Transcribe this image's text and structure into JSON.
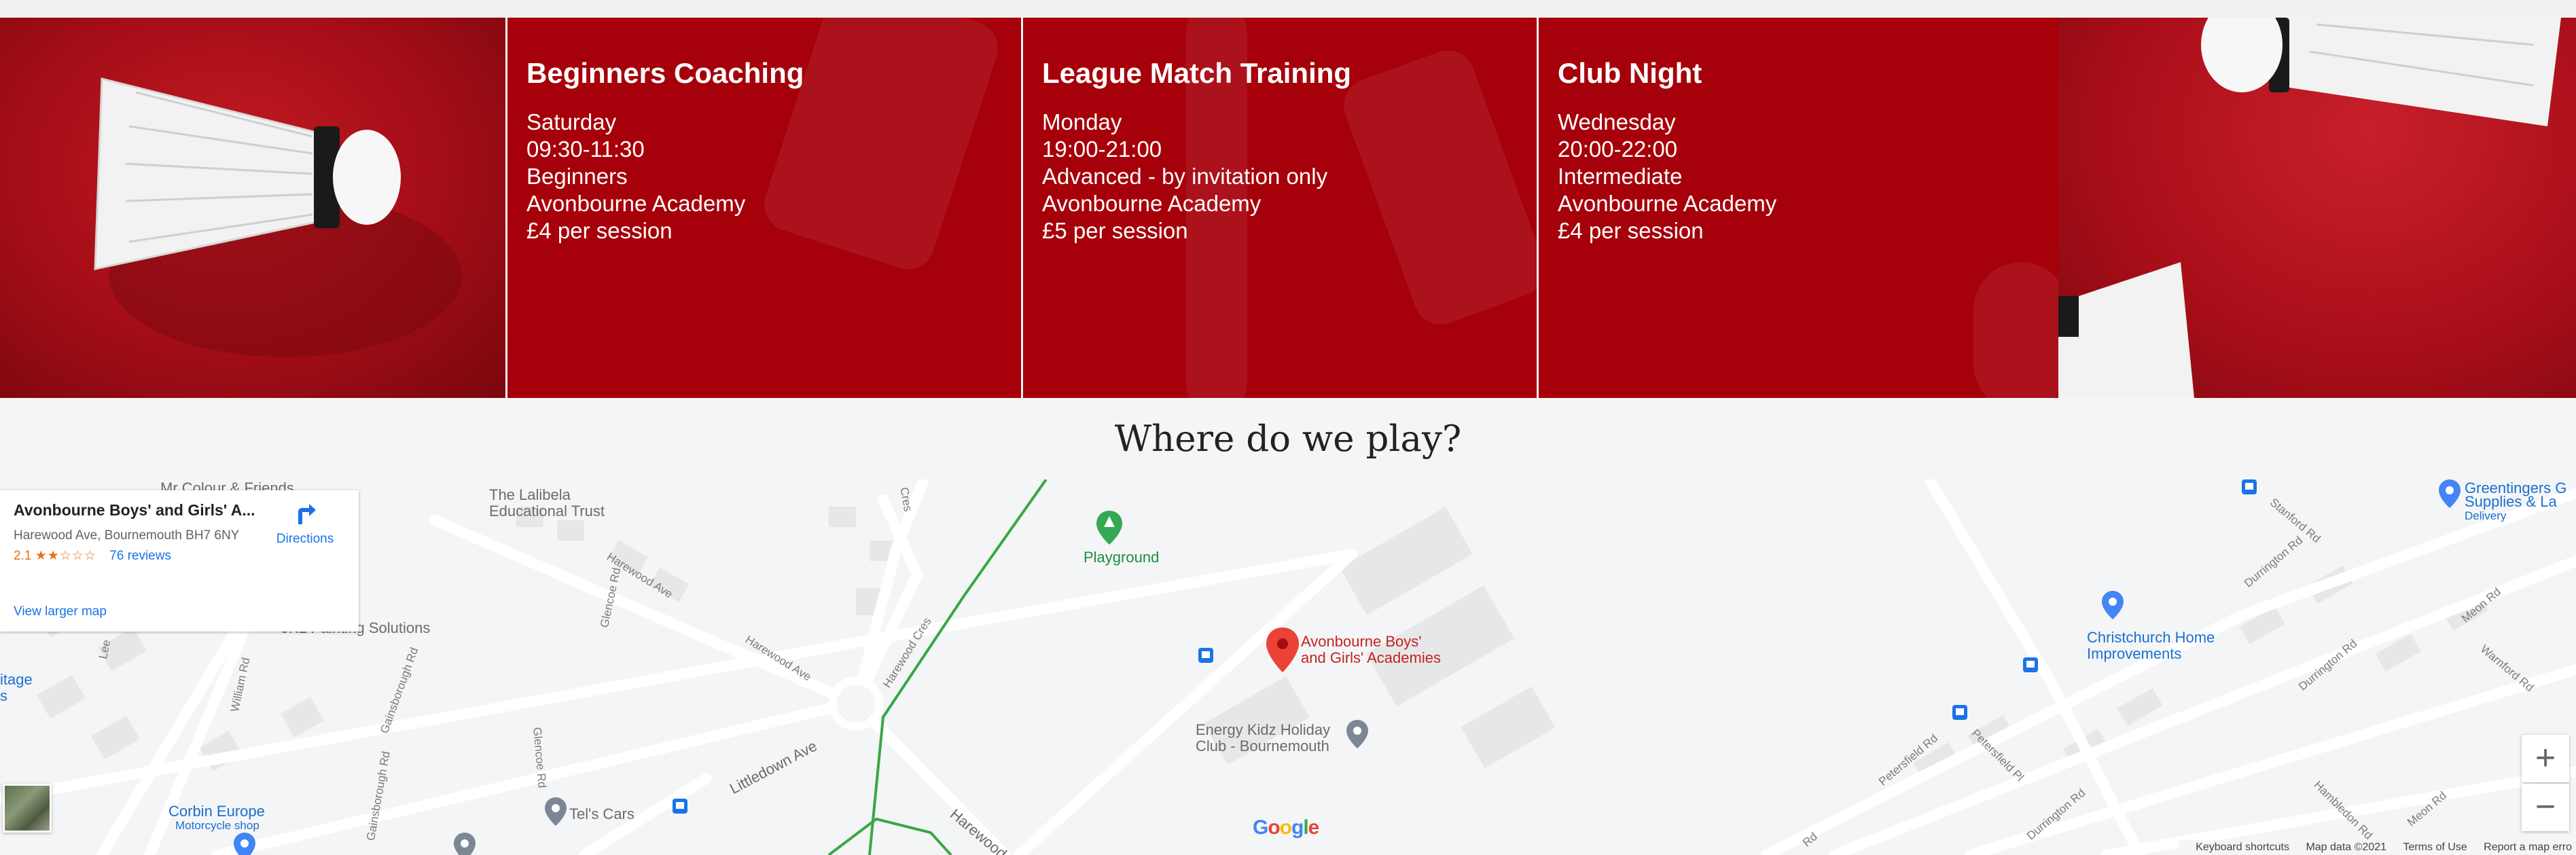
{
  "sessions": [
    {
      "title": "Beginners Coaching",
      "day": "Saturday",
      "time": "09:30-11:30",
      "level": "Beginners",
      "venue": "Avonbourne Academy",
      "price": "£4 per session"
    },
    {
      "title": "League Match Training",
      "day": "Monday",
      "time": "19:00-21:00",
      "level": "Advanced - by invitation only",
      "venue": "Avonbourne Academy",
      "price": "£5 per session"
    },
    {
      "title": "Club Night",
      "day": "Wednesday",
      "time": "20:00-22:00",
      "level": "Intermediate",
      "venue": "Avonbourne Academy",
      "price": "£4 per session"
    }
  ],
  "section_heading": "Where do we play?",
  "map": {
    "card": {
      "title": "Avonbourne Boys' and Girls' A...",
      "address": "Harewood Ave, Bournemouth BH7 6NY",
      "rating": "2.1",
      "stars": "★★☆☆☆",
      "reviews": "76 reviews",
      "directions": "Directions",
      "larger_map": "View larger map"
    },
    "labels": {
      "mr_colour": "Mr Colour & Friends",
      "lalibela_1": "The Lalibela",
      "lalibela_2": "Educational Trust",
      "playground": "Playground",
      "school_1": "Avonbourne Boys'",
      "school_2": "and Girls' Academies",
      "energy_1": "Energy Kidz Holiday",
      "energy_2": "Club - Bournemouth",
      "jkl": "JKL Painting Solutions",
      "tels": "Tel's Cars",
      "corbin_1": "Corbin Europe",
      "corbin_2": "Motorcycle shop",
      "christchurch_1": "Christchurch Home",
      "christchurch_2": "Improvements",
      "greentingers_1": "Greentingers G",
      "greentingers_2": "Supplies & La",
      "greentingers_3": "Delivery",
      "itage": "itage",
      "s_frag": "s",
      "harewood_ave_1": "Harewood Ave",
      "harewood_ave_2": "Harewood Ave",
      "harewood_cres_1": "Harewood Cres",
      "harewood_cres_2": "Cres",
      "harewood_bottom": "Harewood",
      "glencoe_1": "Glencoe Rd",
      "glencoe_2": "Glencoe Rd",
      "littledown": "Littledown Ave",
      "william": "William Rd",
      "gainsborough_1": "Gainsborough Rd",
      "gainsborough_2": "Gainsborough Rd",
      "lee": "Lee",
      "petersfield_rd": "Petersfield Rd",
      "petersfield_pl": "Petersfield Pl",
      "durrington_1": "Durrington Rd",
      "durrington_2": "Durrington Rd",
      "durrington_3": "Durrington Rd",
      "hambledon": "Hambledon Rd",
      "meon_1": "Meon Rd",
      "meon_2": "Meon Rd",
      "warnford": "Warnford Rd",
      "stanford": "Stanford Rd",
      "rd_frag": "Rd"
    },
    "zoom_in": "+",
    "zoom_out": "−",
    "google": [
      "G",
      "o",
      "o",
      "g",
      "l",
      "e"
    ],
    "footer": {
      "shortcuts": "Keyboard shortcuts",
      "data": "Map data ©2021",
      "terms": "Terms of Use",
      "report": "Report a map erro"
    }
  }
}
